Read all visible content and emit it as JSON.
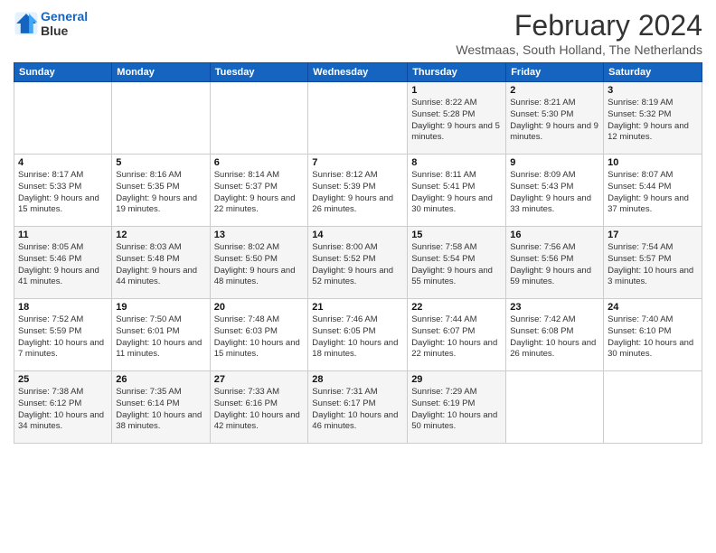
{
  "logo": {
    "line1": "General",
    "line2": "Blue"
  },
  "title": "February 2024",
  "subtitle": "Westmaas, South Holland, The Netherlands",
  "headers": [
    "Sunday",
    "Monday",
    "Tuesday",
    "Wednesday",
    "Thursday",
    "Friday",
    "Saturday"
  ],
  "weeks": [
    [
      {
        "day": "",
        "info": ""
      },
      {
        "day": "",
        "info": ""
      },
      {
        "day": "",
        "info": ""
      },
      {
        "day": "",
        "info": ""
      },
      {
        "day": "1",
        "info": "Sunrise: 8:22 AM\nSunset: 5:28 PM\nDaylight: 9 hours\nand 5 minutes."
      },
      {
        "day": "2",
        "info": "Sunrise: 8:21 AM\nSunset: 5:30 PM\nDaylight: 9 hours\nand 9 minutes."
      },
      {
        "day": "3",
        "info": "Sunrise: 8:19 AM\nSunset: 5:32 PM\nDaylight: 9 hours\nand 12 minutes."
      }
    ],
    [
      {
        "day": "4",
        "info": "Sunrise: 8:17 AM\nSunset: 5:33 PM\nDaylight: 9 hours\nand 15 minutes."
      },
      {
        "day": "5",
        "info": "Sunrise: 8:16 AM\nSunset: 5:35 PM\nDaylight: 9 hours\nand 19 minutes."
      },
      {
        "day": "6",
        "info": "Sunrise: 8:14 AM\nSunset: 5:37 PM\nDaylight: 9 hours\nand 22 minutes."
      },
      {
        "day": "7",
        "info": "Sunrise: 8:12 AM\nSunset: 5:39 PM\nDaylight: 9 hours\nand 26 minutes."
      },
      {
        "day": "8",
        "info": "Sunrise: 8:11 AM\nSunset: 5:41 PM\nDaylight: 9 hours\nand 30 minutes."
      },
      {
        "day": "9",
        "info": "Sunrise: 8:09 AM\nSunset: 5:43 PM\nDaylight: 9 hours\nand 33 minutes."
      },
      {
        "day": "10",
        "info": "Sunrise: 8:07 AM\nSunset: 5:44 PM\nDaylight: 9 hours\nand 37 minutes."
      }
    ],
    [
      {
        "day": "11",
        "info": "Sunrise: 8:05 AM\nSunset: 5:46 PM\nDaylight: 9 hours\nand 41 minutes."
      },
      {
        "day": "12",
        "info": "Sunrise: 8:03 AM\nSunset: 5:48 PM\nDaylight: 9 hours\nand 44 minutes."
      },
      {
        "day": "13",
        "info": "Sunrise: 8:02 AM\nSunset: 5:50 PM\nDaylight: 9 hours\nand 48 minutes."
      },
      {
        "day": "14",
        "info": "Sunrise: 8:00 AM\nSunset: 5:52 PM\nDaylight: 9 hours\nand 52 minutes."
      },
      {
        "day": "15",
        "info": "Sunrise: 7:58 AM\nSunset: 5:54 PM\nDaylight: 9 hours\nand 55 minutes."
      },
      {
        "day": "16",
        "info": "Sunrise: 7:56 AM\nSunset: 5:56 PM\nDaylight: 9 hours\nand 59 minutes."
      },
      {
        "day": "17",
        "info": "Sunrise: 7:54 AM\nSunset: 5:57 PM\nDaylight: 10 hours\nand 3 minutes."
      }
    ],
    [
      {
        "day": "18",
        "info": "Sunrise: 7:52 AM\nSunset: 5:59 PM\nDaylight: 10 hours\nand 7 minutes."
      },
      {
        "day": "19",
        "info": "Sunrise: 7:50 AM\nSunset: 6:01 PM\nDaylight: 10 hours\nand 11 minutes."
      },
      {
        "day": "20",
        "info": "Sunrise: 7:48 AM\nSunset: 6:03 PM\nDaylight: 10 hours\nand 15 minutes."
      },
      {
        "day": "21",
        "info": "Sunrise: 7:46 AM\nSunset: 6:05 PM\nDaylight: 10 hours\nand 18 minutes."
      },
      {
        "day": "22",
        "info": "Sunrise: 7:44 AM\nSunset: 6:07 PM\nDaylight: 10 hours\nand 22 minutes."
      },
      {
        "day": "23",
        "info": "Sunrise: 7:42 AM\nSunset: 6:08 PM\nDaylight: 10 hours\nand 26 minutes."
      },
      {
        "day": "24",
        "info": "Sunrise: 7:40 AM\nSunset: 6:10 PM\nDaylight: 10 hours\nand 30 minutes."
      }
    ],
    [
      {
        "day": "25",
        "info": "Sunrise: 7:38 AM\nSunset: 6:12 PM\nDaylight: 10 hours\nand 34 minutes."
      },
      {
        "day": "26",
        "info": "Sunrise: 7:35 AM\nSunset: 6:14 PM\nDaylight: 10 hours\nand 38 minutes."
      },
      {
        "day": "27",
        "info": "Sunrise: 7:33 AM\nSunset: 6:16 PM\nDaylight: 10 hours\nand 42 minutes."
      },
      {
        "day": "28",
        "info": "Sunrise: 7:31 AM\nSunset: 6:17 PM\nDaylight: 10 hours\nand 46 minutes."
      },
      {
        "day": "29",
        "info": "Sunrise: 7:29 AM\nSunset: 6:19 PM\nDaylight: 10 hours\nand 50 minutes."
      },
      {
        "day": "",
        "info": ""
      },
      {
        "day": "",
        "info": ""
      }
    ]
  ]
}
